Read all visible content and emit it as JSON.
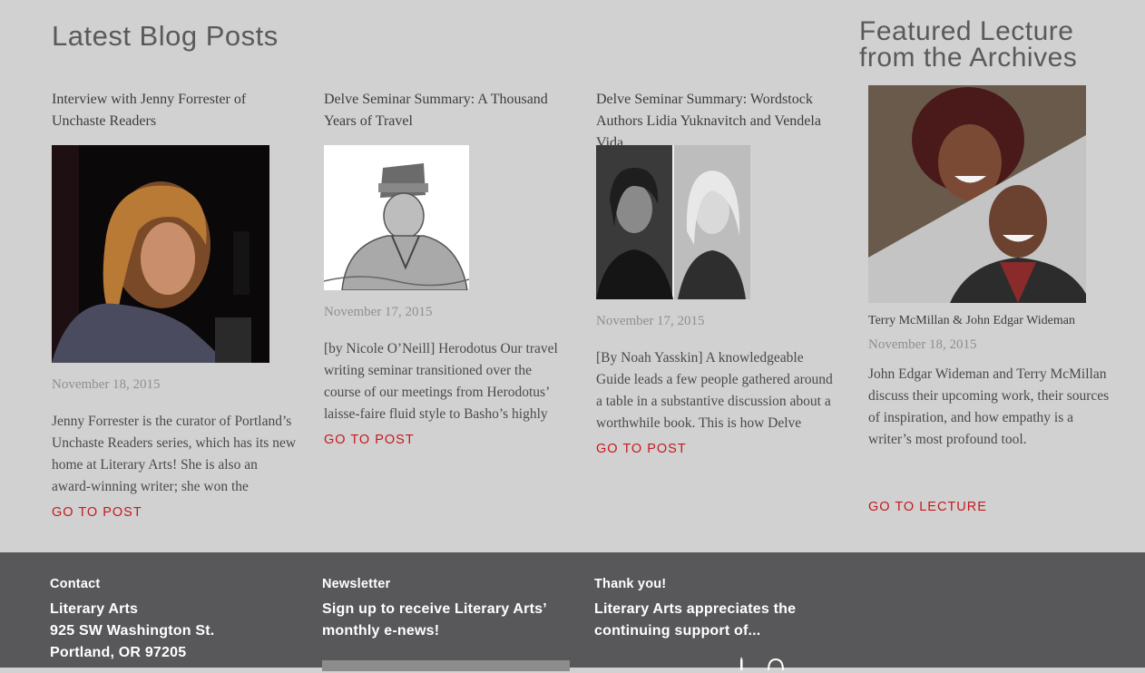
{
  "blog": {
    "heading": "Latest Blog Posts",
    "posts": [
      {
        "title": "Interview with Jenny Forrester of Unchaste Readers",
        "date": "November 18, 2015",
        "excerpt": "Jenny Forrester is the curator of Portland’s Unchaste Readers series, which has its new home at Literary Arts! She is also an award-winning writer; she won the",
        "link": "GO TO POST"
      },
      {
        "title": "Delve Seminar Summary: A Thousand Years of Travel",
        "date": "November 17, 2015",
        "excerpt": "[by Nicole O’Neill] Herodotus Our travel writing seminar transitioned over the course of our meetings from Herodotus’ laisse-faire fluid style to Basho’s highly",
        "link": "GO TO POST"
      },
      {
        "title": "Delve Seminar Summary: Wordstock Authors Lidia Yuknavitch and Vendela Vida",
        "date": "November 17, 2015",
        "excerpt": "[By Noah Yasskin] A knowledgeable Guide leads a few people gathered around a table in a substantive discussion about a worthwhile book. This is how Delve",
        "link": "GO TO POST"
      }
    ]
  },
  "featured": {
    "heading": "Featured Lecture from the Archives",
    "caption": "Terry McMillan & John Edgar Wideman",
    "date": "November 18, 2015",
    "excerpt": "John Edgar Wideman and Terry McMillan discuss their upcoming work, their sources of inspiration, and how empathy is a writer’s most profound tool.",
    "link": "GO TO LECTURE"
  },
  "footer": {
    "contact": {
      "heading": "Contact",
      "lines": [
        "Literary Arts",
        "925 SW Washington St.",
        "Portland, OR 97205"
      ]
    },
    "newsletter": {
      "heading": "Newsletter",
      "text": "Sign up to receive Literary Arts’ monthly e-news!"
    },
    "thanks": {
      "heading": "Thank you!",
      "text": "Literary Arts appreciates the continuing support of..."
    },
    "social_icons": [
      "instagram-icon",
      "pinterest-icon"
    ]
  },
  "colors": {
    "background": "#d1d1d1",
    "footer": "#58585a",
    "link_red": "#c5191f",
    "heading_gray": "#5a5a5a"
  }
}
